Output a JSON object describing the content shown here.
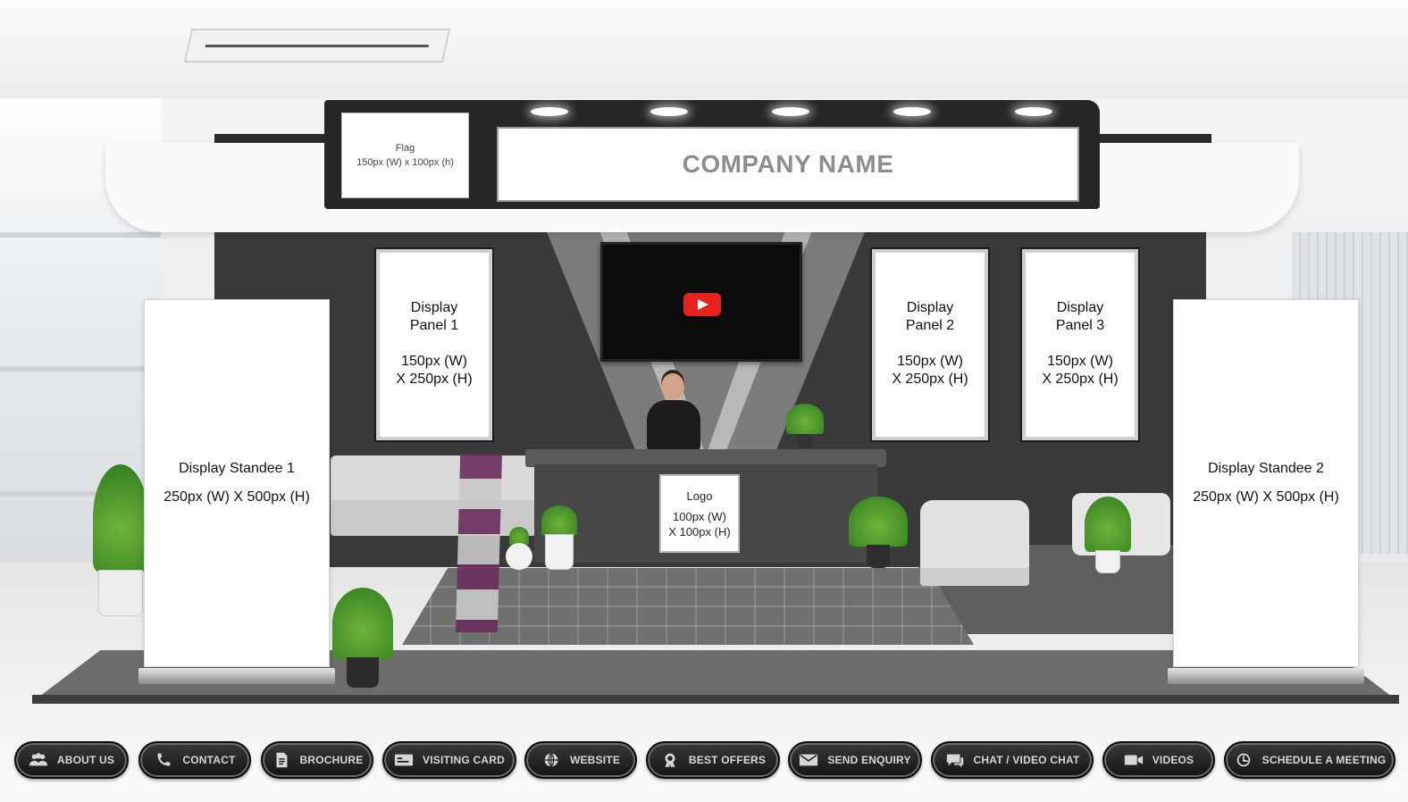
{
  "booth": {
    "company_name": "COMPANY NAME",
    "flag": {
      "title": "Flag",
      "size": "150px (W) x 100px (h)"
    },
    "panels": [
      {
        "title_line1": "Display",
        "title_line2": "Panel 1",
        "size_line1": "150px (W)",
        "size_line2": "X 250px (H)"
      },
      {
        "title_line1": "Display",
        "title_line2": "Panel 2",
        "size_line1": "150px (W)",
        "size_line2": "X 250px (H)"
      },
      {
        "title_line1": "Display",
        "title_line2": "Panel 3",
        "size_line1": "150px (W)",
        "size_line2": "X 250px (H)"
      }
    ],
    "standees": [
      {
        "title": "Display  Standee 1",
        "size": "250px (W) X 500px (H)"
      },
      {
        "title": "Display  Standee 2",
        "size": "250px (W) X 500px (H)"
      }
    ],
    "logo": {
      "title": "Logo",
      "size_line1": "100px (W)",
      "size_line2": "X 100px (H)"
    },
    "video": {
      "icon": "play-icon",
      "color": "#e5221c"
    }
  },
  "nav": [
    {
      "label": "ABOUT US",
      "icon": "users-icon"
    },
    {
      "label": "CONTACT",
      "icon": "phone-icon"
    },
    {
      "label": "BROCHURE",
      "icon": "document-icon"
    },
    {
      "label": "VISITING CARD",
      "icon": "card-icon"
    },
    {
      "label": "WEBSITE",
      "icon": "globe-icon"
    },
    {
      "label": "BEST OFFERS",
      "icon": "badge-icon"
    },
    {
      "label": "SEND ENQUIRY",
      "icon": "mail-icon"
    },
    {
      "label": "CHAT / VIDEO CHAT",
      "icon": "chat-icon"
    },
    {
      "label": "VIDEOS",
      "icon": "video-icon"
    },
    {
      "label": "SCHEDULE A MEETING",
      "icon": "clock-icon"
    }
  ],
  "colors": {
    "nav_bg": "#1a1a1a",
    "nav_text": "#d7d7d7",
    "booth_dark": "#3a3a3a"
  }
}
